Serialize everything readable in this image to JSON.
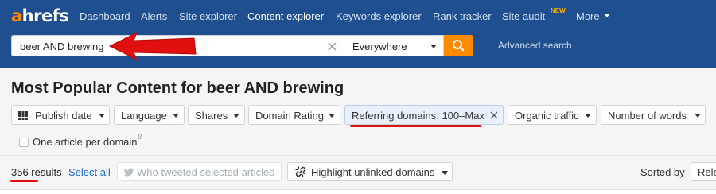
{
  "brand": {
    "logo_accent": "a",
    "logo_rest": "hrefs"
  },
  "nav": {
    "items": [
      "Dashboard",
      "Alerts",
      "Site explorer",
      "Content explorer",
      "Keywords explorer",
      "Rank tracker",
      "Site audit",
      "More"
    ],
    "active": "Content explorer",
    "new_badge": "NEW"
  },
  "search": {
    "query": "beer AND brewing",
    "scope": "Everywhere",
    "advanced_link": "Advanced search"
  },
  "page": {
    "title": "Most Popular Content for beer AND brewing"
  },
  "filters": [
    {
      "label": "Publish date",
      "icon": "grid-icon"
    },
    {
      "label": "Language"
    },
    {
      "label": "Shares"
    },
    {
      "label": "Domain Rating"
    },
    {
      "label": "Referring domains: 100–Max",
      "active": true
    },
    {
      "label": "Organic traffic"
    },
    {
      "label": "Number of words"
    }
  ],
  "options": {
    "one_per_domain": "One article per domain",
    "beta": "β"
  },
  "results": {
    "count": "356 results",
    "select_all": "Select all",
    "tweet_button": "Who tweeted selected articles",
    "highlight_button": "Highlight unlinked domains",
    "sorted_by_label": "Sorted by",
    "sort_value": "Relevance"
  },
  "colors": {
    "topbar": "#1f4f8f",
    "accent_orange": "#ff8a00",
    "annotation_red": "#e01010",
    "link_blue": "#1a6ad2"
  }
}
